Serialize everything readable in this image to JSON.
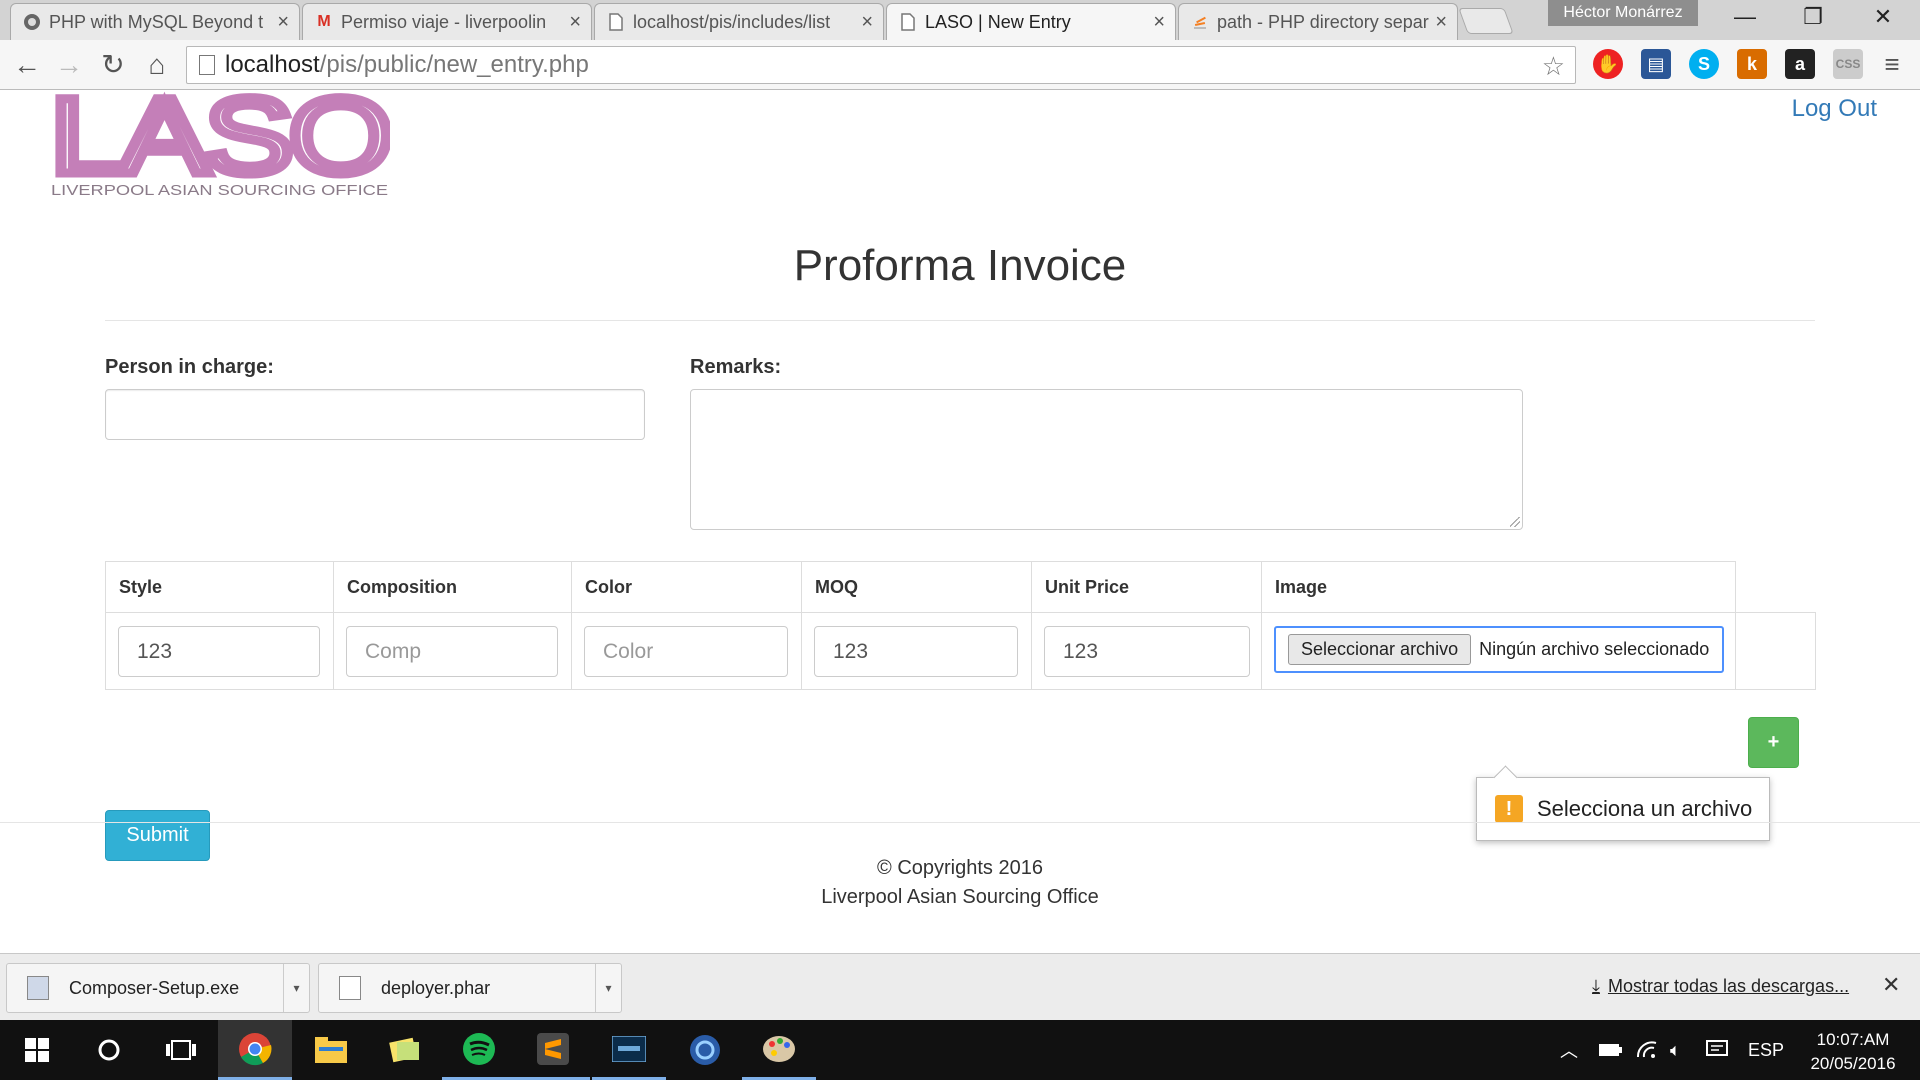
{
  "browser": {
    "tabs": [
      {
        "title": "PHP with MySQL Beyond t",
        "icon": "globe-icon"
      },
      {
        "title": "Permiso viaje - liverpoolin",
        "icon": "gmail-icon"
      },
      {
        "title": "localhost/pis/includes/list",
        "icon": "page-icon"
      },
      {
        "title": "LASO | New Entry",
        "icon": "page-icon",
        "active": true
      },
      {
        "title": "path - PHP directory separ",
        "icon": "stackoverflow-icon"
      }
    ],
    "profile_name": "Héctor Monárrez",
    "url_host": "localhost",
    "url_path": "/pis/public/new_entry.php"
  },
  "page": {
    "logo_text": "LASO",
    "logo_subtext": "LIVERPOOL ASIAN SOURCING OFFICE",
    "logout_label": "Log Out",
    "title": "Proforma Invoice",
    "person_label": "Person in charge:",
    "person_value": "",
    "remarks_label": "Remarks:",
    "table": {
      "headers": [
        "Style",
        "Composition",
        "Color",
        "MOQ",
        "Unit Price",
        "Image"
      ],
      "row": {
        "style": "123",
        "composition_placeholder": "Comp",
        "color_placeholder": "Color",
        "moq": "123",
        "unit_price": "123",
        "file_button": "Seleccionar archivo",
        "file_status": "Ningún archivo seleccionado"
      }
    },
    "plus_label": "+",
    "submit_label": "Submit",
    "validation_message": "Selecciona un archivo",
    "footer_line1": "© Copyrights 2016",
    "footer_line2": "Liverpool Asian Sourcing Office"
  },
  "downloads": {
    "items": [
      "Composer-Setup.exe",
      "deployer.phar"
    ],
    "show_all": "Mostrar todas las descargas..."
  },
  "taskbar": {
    "language": "ESP",
    "time": "10:07:AM",
    "date": "20/05/2016"
  },
  "colors": {
    "logo": "#c47fb8",
    "link": "#337ab7",
    "submit": "#31b0d5",
    "add": "#5cb85c",
    "warning": "#f5a623"
  }
}
